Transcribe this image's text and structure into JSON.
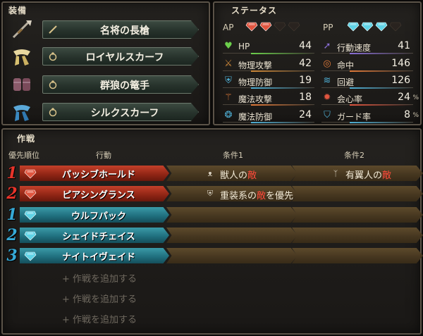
{
  "equipment": {
    "title": "装備",
    "items": [
      {
        "name": "名将の長槍",
        "icon": "spear-icon",
        "slot_icon": "weapon-slot-icon"
      },
      {
        "name": "ロイヤルスカーフ",
        "icon": "scarf-icon",
        "slot_icon": "ring-slot-icon"
      },
      {
        "name": "群狼の篭手",
        "icon": "gauntlet-icon",
        "slot_icon": "ring-slot-icon"
      },
      {
        "name": "シルクスカーフ",
        "icon": "blue-scarf-icon",
        "slot_icon": "ring-slot-icon"
      }
    ]
  },
  "status": {
    "title": "ステータス",
    "ap_label": "AP",
    "pp_label": "PP",
    "ap_filled": 2,
    "ap_total": 4,
    "pp_filled": 3,
    "pp_total": 4,
    "ap_color": "#e0553f",
    "pp_color": "#5fd3e6",
    "left": [
      {
        "label": "HP",
        "value": "44",
        "icon": "heart-icon",
        "color": "#6ccf4c"
      },
      {
        "label": "物理攻撃",
        "value": "42",
        "icon": "sword-icon",
        "color": "#d08a3a"
      },
      {
        "label": "物理防御",
        "value": "19",
        "icon": "armor-icon",
        "color": "#4fb0d6"
      },
      {
        "label": "魔法攻撃",
        "value": "18",
        "icon": "wand-icon",
        "color": "#e07a3a"
      },
      {
        "label": "魔法防御",
        "value": "24",
        "icon": "magic-shield-icon",
        "color": "#4fb0d6"
      }
    ],
    "right": [
      {
        "label": "行動速度",
        "value": "41",
        "unit": "",
        "icon": "speed-icon",
        "color": "#8a6fd6"
      },
      {
        "label": "命中",
        "value": "146",
        "unit": "",
        "icon": "target-icon",
        "color": "#e07a3a"
      },
      {
        "label": "回避",
        "value": "126",
        "unit": "",
        "icon": "evade-icon",
        "color": "#4fb0d6"
      },
      {
        "label": "会心率",
        "value": "24",
        "unit": "%",
        "icon": "critical-icon",
        "color": "#e0553f"
      },
      {
        "label": "ガード率",
        "value": "8",
        "unit": "%",
        "icon": "guard-icon",
        "color": "#4fb0d6"
      }
    ]
  },
  "tactics": {
    "title": "作戦",
    "headers": {
      "priority": "優先順位",
      "action": "行動",
      "cond1": "条件1",
      "cond2": "条件2"
    },
    "rows": [
      {
        "num": "1",
        "type": "ap",
        "action": "パッシブホールド",
        "cond1": {
          "icon": "beast-icon",
          "before": "獣人の",
          "enemy": "敵",
          "after": ""
        },
        "cond2": {
          "icon": "winged-icon",
          "before": "有翼人の",
          "enemy": "敵",
          "after": ""
        }
      },
      {
        "num": "2",
        "type": "ap",
        "action": "ピアシングランス",
        "cond1": {
          "icon": "armor-type-icon",
          "before": "重装系の",
          "enemy": "敵",
          "after": "を優先"
        },
        "cond2": null
      },
      {
        "num": "1",
        "type": "pp",
        "action": "ウルフパック",
        "cond1": null,
        "cond2": null
      },
      {
        "num": "2",
        "type": "pp",
        "action": "シェイドチェイス",
        "cond1": null,
        "cond2": null
      },
      {
        "num": "3",
        "type": "pp",
        "action": "ナイトイヴェイド",
        "cond1": null,
        "cond2": null
      }
    ],
    "add_labels": [
      "+ 作戦を追加する",
      "+ 作戦を追加する",
      "+ 作戦を追加する"
    ]
  }
}
